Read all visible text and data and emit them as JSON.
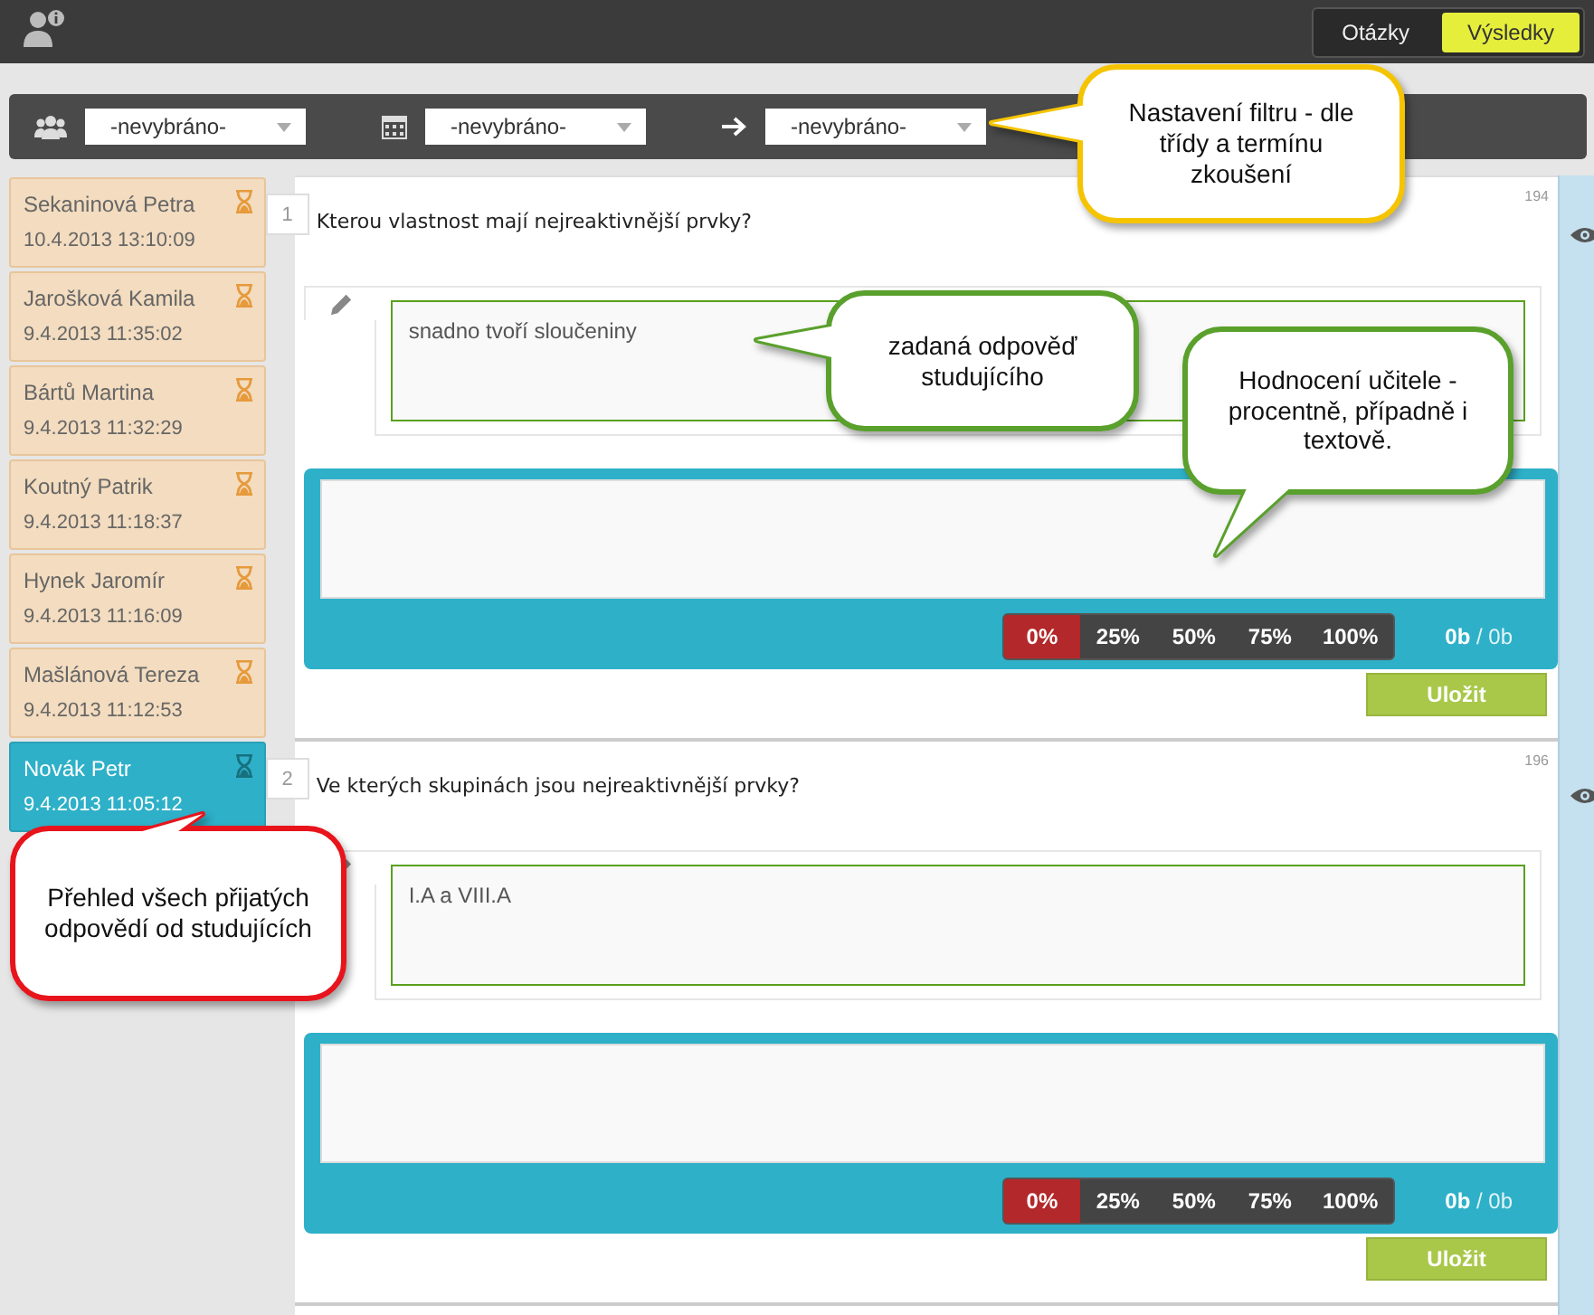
{
  "header": {
    "tabs": [
      {
        "label": "Otázky",
        "selected": false
      },
      {
        "label": "Výsledky",
        "selected": true
      }
    ]
  },
  "filters": [
    {
      "kind": "group",
      "value": "-nevybráno-"
    },
    {
      "kind": "date",
      "value": "-nevybráno-"
    },
    {
      "kind": "arrow",
      "value": "-nevybráno-"
    }
  ],
  "students": [
    {
      "name": "Sekaninová Petra",
      "time": "10.4.2013 13:10:09",
      "selected": false
    },
    {
      "name": "Jarošková Kamila",
      "time": "9.4.2013 11:35:02",
      "selected": false
    },
    {
      "name": "Bártů Martina",
      "time": "9.4.2013 11:32:29",
      "selected": false
    },
    {
      "name": "Koutný Patrik",
      "time": "9.4.2013 11:18:37",
      "selected": false
    },
    {
      "name": "Hynek Jaromír",
      "time": "9.4.2013 11:16:09",
      "selected": false
    },
    {
      "name": "Mašlánová Tereza",
      "time": "9.4.2013 11:12:53",
      "selected": false
    },
    {
      "name": "Novák Petr",
      "time": "9.4.2013 11:05:12",
      "selected": true
    }
  ],
  "questions": [
    {
      "number": "1",
      "code": "194",
      "text": "Kterou vlastnost mají nejreaktivnější prvky?",
      "answer": "snadno tvoří sloučeniny",
      "grades": [
        {
          "label": "0%",
          "selected": true
        },
        {
          "label": "25%",
          "selected": false
        },
        {
          "label": "50%",
          "selected": false
        },
        {
          "label": "75%",
          "selected": false
        },
        {
          "label": "100%",
          "selected": false
        }
      ],
      "score": "**0b** / 0b",
      "save": "Uložit"
    },
    {
      "number": "2",
      "code": "196",
      "text": "Ve kterých skupinách jsou nejreaktivnější prvky?",
      "answer": "I.A a VIII.A",
      "grades": [
        {
          "label": "0%",
          "selected": true
        },
        {
          "label": "25%",
          "selected": false
        },
        {
          "label": "50%",
          "selected": false
        },
        {
          "label": "75%",
          "selected": false
        },
        {
          "label": "100%",
          "selected": false
        }
      ],
      "score": "**0b** / 0b",
      "save": "Uložit"
    }
  ],
  "callouts": [
    {
      "text": "Nastavení filtru - dle třídy a termínu zkoušení",
      "color": "#f5c400"
    },
    {
      "text": "zadaná odpověď studujícího",
      "color": "#5aa02c"
    },
    {
      "text": "Hodnocení učitele - procentně, případně i textově.",
      "color": "#5aa02c"
    },
    {
      "text": "Přehled všech přijatých odpovědí od studujících",
      "color": "#e8141c"
    }
  ]
}
